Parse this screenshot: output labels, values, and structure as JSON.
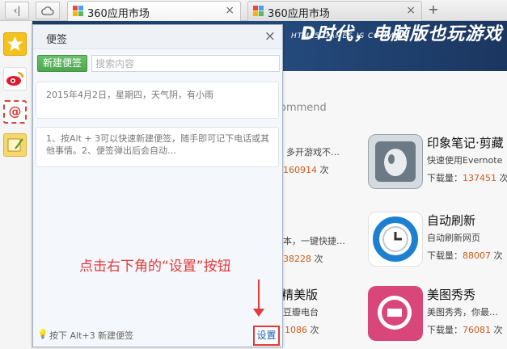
{
  "browser": {
    "back_glyph": "ᐊ|",
    "tabs": [
      {
        "label": "360应用市场",
        "close": "×"
      },
      {
        "label": "360应用市场",
        "close": "×"
      }
    ],
    "new_tab": "+"
  },
  "page": {
    "banner_title": "D时代，电脑版也玩游戏",
    "banner_subtitle": "HTML5 GAMES IS COMMING",
    "section_label": "ommend",
    "apps_right": [
      {
        "name": "印象笔记·剪藏",
        "desc": "快速使用Evernote",
        "dl_label": "下载量：",
        "dl_count": "137451",
        "dl_unit": "次"
      },
      {
        "name": "自动刷新",
        "desc": "自动刷新网页",
        "dl_label": "下载量：",
        "dl_count": "88007",
        "dl_unit": "次"
      },
      {
        "name": "美图秀秀",
        "desc": "美图秀秀，你最…",
        "dl_label": "下载量：",
        "dl_count": "76081",
        "dl_unit": "次"
      }
    ],
    "apps_left": [
      {
        "name": "",
        "desc": "多开游戏不…",
        "dl_count": "160914",
        "dl_unit": "次"
      },
      {
        "name": "",
        "desc": "本，一键快捷…",
        "dl_count": "38228",
        "dl_unit": "次"
      },
      {
        "name": "精美版",
        "desc": "豆瓣电台",
        "dl_count": "1086",
        "dl_unit": "次"
      }
    ]
  },
  "note": {
    "title": "便签",
    "close": "×",
    "new_button": "新建便签",
    "search_placeholder": "搜索内容",
    "cards": [
      "2015年4月2日，星期四，天气阴，有小雨",
      "1、按Alt + 3可以快速新建便签，随手即可记下电话或其他事情。2、便签弹出后会自动…"
    ],
    "footer_tip": "按下 Alt+3 新建便签",
    "settings_button": "设置"
  },
  "annotation": {
    "text": "点击右下角的“设置”按钮",
    "color": "#e23a3a"
  }
}
